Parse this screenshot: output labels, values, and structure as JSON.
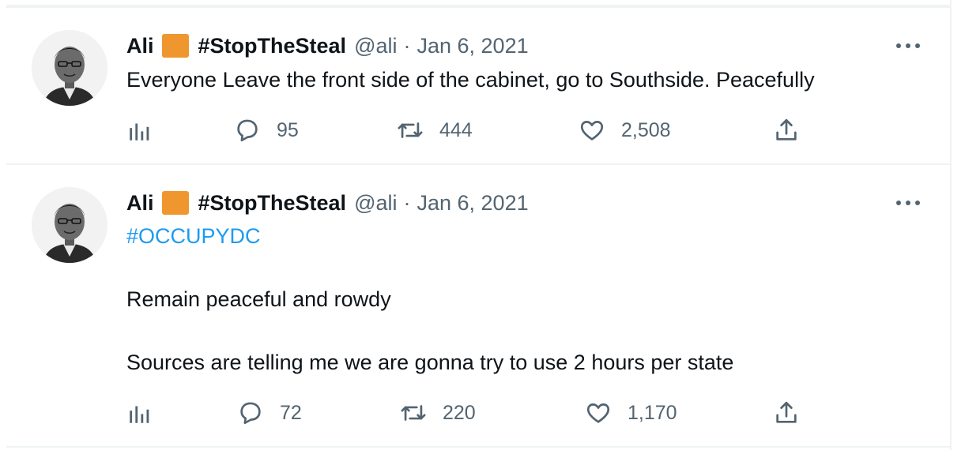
{
  "tweets": [
    {
      "name": "Ali",
      "tag": "#StopTheSteal",
      "handle": "@ali",
      "separator": "·",
      "date": "Jan 6, 2021",
      "text": "Everyone Leave the front side of the cabinet, go to Southside. Peacefully",
      "replies": "95",
      "retweets": "444",
      "likes": "2,508",
      "flag_color": "#f0962f"
    },
    {
      "name": "Ali",
      "tag": "#StopTheSteal",
      "handle": "@ali",
      "separator": "·",
      "date": "Jan 6, 2021",
      "hashtag": "#OCCUPYDC",
      "line2": "Remain peaceful and rowdy",
      "line3": "Sources are telling me we are gonna try to use 2 hours per state",
      "replies": "72",
      "retweets": "220",
      "likes": "1,170",
      "flag_color": "#f0962f"
    }
  ],
  "colors": {
    "text": "#0f1419",
    "secondary": "#536471",
    "link": "#1d9bf0",
    "border": "#eff3f4"
  },
  "icons": [
    "analytics-icon",
    "reply-icon",
    "retweet-icon",
    "like-icon",
    "share-icon",
    "more-icon"
  ]
}
